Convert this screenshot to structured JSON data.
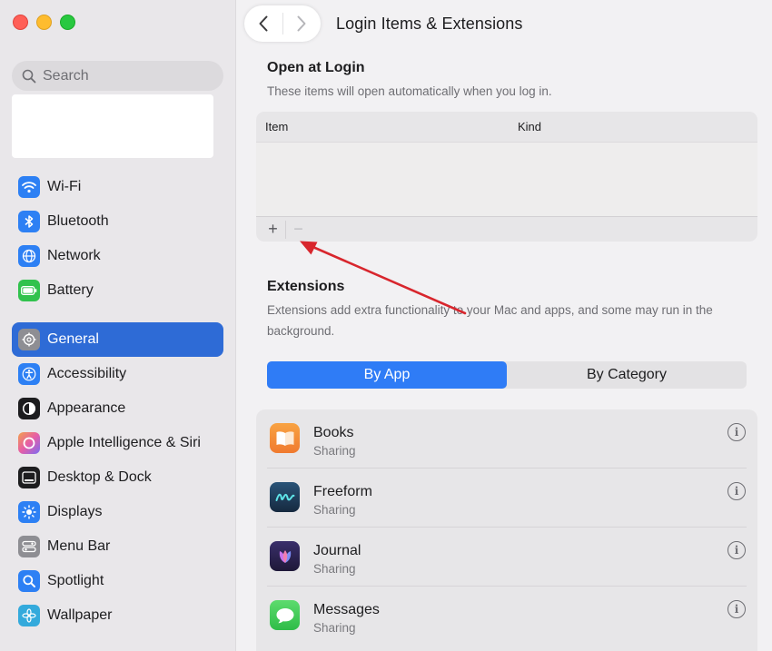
{
  "window": {
    "title": "Login Items & Extensions"
  },
  "sidebar": {
    "search_placeholder": "Search",
    "items": [
      {
        "label": "Wi-Fi",
        "icon": "wifi-icon",
        "color": "#2d80f4"
      },
      {
        "label": "Bluetooth",
        "icon": "bluetooth-icon",
        "color": "#2d80f4"
      },
      {
        "label": "Network",
        "icon": "globe-icon",
        "color": "#2d80f4"
      },
      {
        "label": "Battery",
        "icon": "battery-icon",
        "color": "#31c24d"
      },
      {
        "label": "General",
        "icon": "gear-icon",
        "color": "#8e8e93",
        "selected": true
      },
      {
        "label": "Accessibility",
        "icon": "accessibility-icon",
        "color": "#2d80f4"
      },
      {
        "label": "Appearance",
        "icon": "appearance-icon",
        "color": "#1d1d1f"
      },
      {
        "label": "Apple Intelligence & Siri",
        "icon": "siri-icon",
        "color": "#c56df2"
      },
      {
        "label": "Desktop & Dock",
        "icon": "dock-icon",
        "color": "#1d1d1f"
      },
      {
        "label": "Displays",
        "icon": "sun-icon",
        "color": "#2d80f4"
      },
      {
        "label": "Menu Bar",
        "icon": "menu-bar-icon",
        "color": "#8e8e93"
      },
      {
        "label": "Spotlight",
        "icon": "spotlight-icon",
        "color": "#2d80f4"
      },
      {
        "label": "Wallpaper",
        "icon": "wallpaper-icon",
        "color": "#34aadc"
      }
    ]
  },
  "open_at_login": {
    "title": "Open at Login",
    "description": "These items will open automatically when you log in.",
    "columns": {
      "item": "Item",
      "kind": "Kind"
    },
    "add_label": "+",
    "remove_label": "−"
  },
  "extensions": {
    "title": "Extensions",
    "description_line1": "Extensions add extra functionality to your Mac and apps, and some may run in the",
    "description_line2": "background.",
    "segments": {
      "by_app": "By App",
      "by_category": "By Category"
    },
    "apps": [
      {
        "name": "Books",
        "detail": "Sharing",
        "icon": "books-icon",
        "color": "#f5923e"
      },
      {
        "name": "Freeform",
        "detail": "Sharing",
        "icon": "freeform-icon",
        "color": "#1f3b5c"
      },
      {
        "name": "Journal",
        "detail": "Sharing",
        "icon": "journal-icon",
        "color": "#2b2350"
      },
      {
        "name": "Messages",
        "detail": "Sharing",
        "icon": "messages-icon",
        "color": "#3ecb54"
      }
    ]
  },
  "accent_color": "#2f7cf6",
  "annotation_color": "#d8262d"
}
